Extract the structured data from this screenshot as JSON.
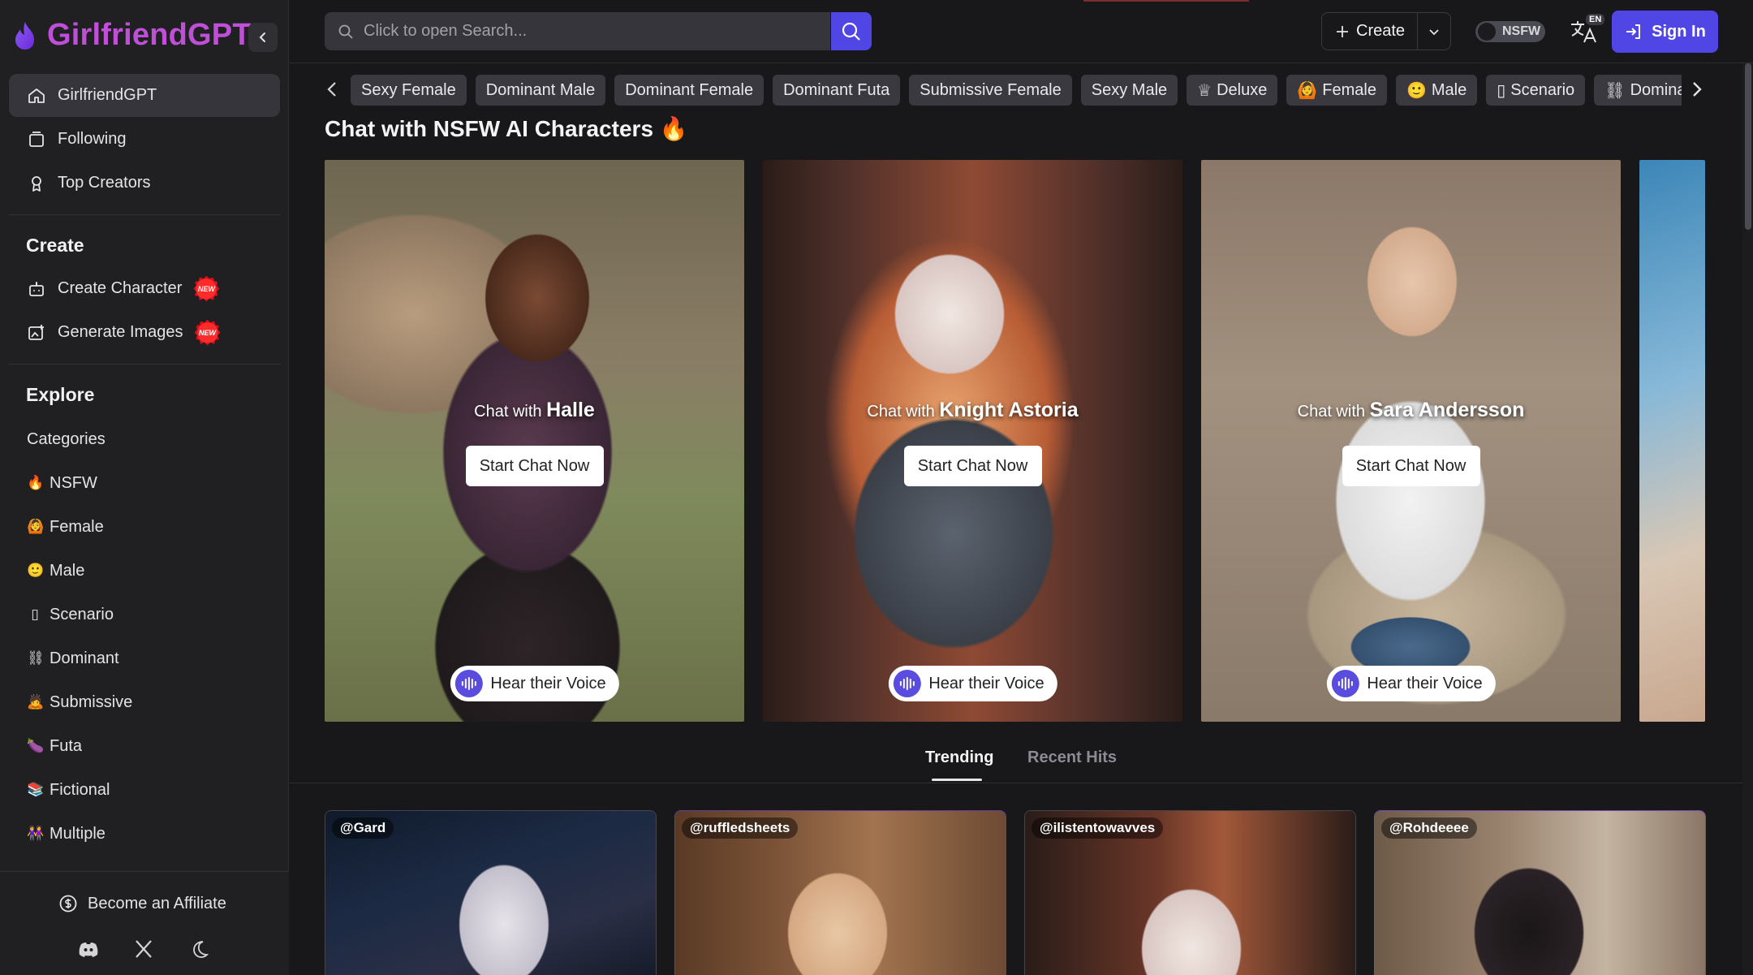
{
  "brand": {
    "name": "GirlfriendGPT"
  },
  "nav": [
    {
      "label": "GirlfriendGPT",
      "icon": "home-icon"
    },
    {
      "label": "Following",
      "icon": "following-icon"
    },
    {
      "label": "Top Creators",
      "icon": "award-icon"
    }
  ],
  "create_section": {
    "title": "Create",
    "items": [
      {
        "label": "Create Character",
        "badge": "NEW"
      },
      {
        "label": "Generate Images",
        "badge": "NEW"
      }
    ]
  },
  "explore_section": {
    "title": "Explore",
    "items": [
      {
        "label": "Categories",
        "emoji": ""
      },
      {
        "label": "NSFW",
        "emoji": "🔥"
      },
      {
        "label": "Female",
        "emoji": "🙆"
      },
      {
        "label": "Male",
        "emoji": "🙂"
      },
      {
        "label": "Scenario",
        "emoji": "▯"
      },
      {
        "label": "Dominant",
        "emoji": "⛓"
      },
      {
        "label": "Submissive",
        "emoji": "🙇"
      },
      {
        "label": "Futa",
        "emoji": "🍆"
      },
      {
        "label": "Fictional",
        "emoji": "📚"
      },
      {
        "label": "Multiple",
        "emoji": "👭"
      }
    ]
  },
  "footer": {
    "affiliate_label": "Become an Affiliate"
  },
  "header": {
    "search_placeholder": "Click to open Search...",
    "create_label": "Create",
    "nsfw_label": "NSFW",
    "lang_badge": "EN",
    "signin_label": "Sign In"
  },
  "tags": [
    {
      "label": "Sexy Female",
      "emoji": ""
    },
    {
      "label": "Dominant Male",
      "emoji": ""
    },
    {
      "label": "Dominant Female",
      "emoji": ""
    },
    {
      "label": "Dominant Futa",
      "emoji": ""
    },
    {
      "label": "Submissive Female",
      "emoji": ""
    },
    {
      "label": "Sexy Male",
      "emoji": ""
    },
    {
      "label": "Deluxe",
      "emoji": "♕"
    },
    {
      "label": "Female",
      "emoji": "🙆"
    },
    {
      "label": "Male",
      "emoji": "🙂"
    },
    {
      "label": "Scenario",
      "emoji": "▯"
    },
    {
      "label": "Dominant",
      "emoji": "⛓"
    }
  ],
  "page_title": "Chat with NSFW AI Characters 🔥",
  "hero": [
    {
      "chat_prefix": "Chat with",
      "name": "Halle",
      "cta": "Start Chat Now",
      "voice": "Hear their Voice"
    },
    {
      "chat_prefix": "Chat with",
      "name": "Knight Astoria",
      "cta": "Start Chat Now",
      "voice": "Hear their Voice"
    },
    {
      "chat_prefix": "Chat with",
      "name": "Sara Andersson",
      "cta": "Start Chat Now",
      "voice": "Hear their Voice"
    }
  ],
  "tabs": {
    "trending": "Trending",
    "recent": "Recent Hits"
  },
  "grid": [
    {
      "creator": "@Gard"
    },
    {
      "creator": "@ruffledsheets"
    },
    {
      "creator": "@ilistentowavves"
    },
    {
      "creator": "@Rohdeeee"
    }
  ],
  "colors": {
    "accent": "#4f46e5",
    "brand": "#c04fd8",
    "background": "#18181b",
    "sidebar": "#202023"
  }
}
